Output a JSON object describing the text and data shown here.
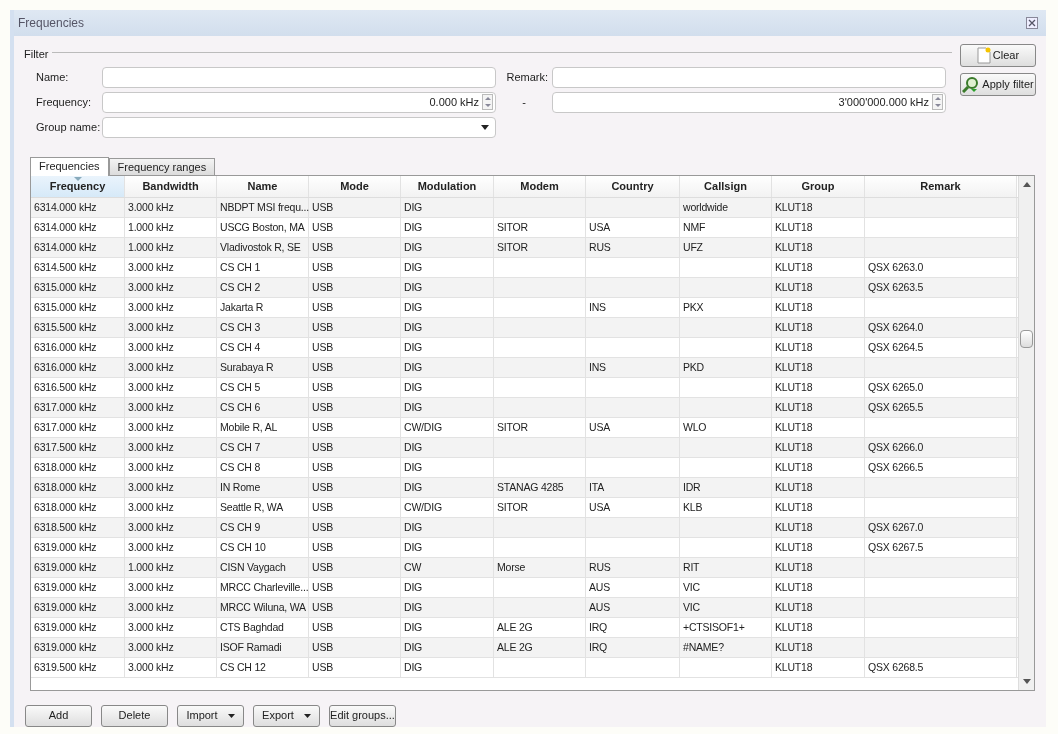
{
  "window": {
    "title": "Frequencies"
  },
  "filter": {
    "legend": "Filter",
    "name": {
      "label": "Name:"
    },
    "remark": {
      "label": "Remark:"
    },
    "frequency": {
      "label": "Frequency:",
      "from": "0.000 kHz",
      "separator": "-",
      "to": "3'000'000.000 kHz"
    },
    "group": {
      "label": "Group name:"
    },
    "buttons": [
      {
        "label": "Clear",
        "kind": "clear"
      },
      {
        "label": "Apply filter",
        "kind": "apply"
      }
    ]
  },
  "tabs": [
    {
      "label": "Frequencies",
      "selected": true
    },
    {
      "label": "Frequency ranges",
      "selected": false
    }
  ],
  "table": {
    "columns": [
      {
        "label": "Frequency",
        "sorted": true
      },
      {
        "label": "Bandwidth",
        "sorted": false
      },
      {
        "label": "Name",
        "sorted": false
      },
      {
        "label": "Mode",
        "sorted": false
      },
      {
        "label": "Modulation",
        "sorted": false
      },
      {
        "label": "Modem",
        "sorted": false
      },
      {
        "label": "Country",
        "sorted": false
      },
      {
        "label": "Callsign",
        "sorted": false
      },
      {
        "label": "Group",
        "sorted": false
      },
      {
        "label": "Remark",
        "sorted": false
      }
    ],
    "rows": [
      [
        "6314.000 kHz",
        "3.000 kHz",
        "NBDPT MSI frequ...",
        "USB",
        "DIG",
        "",
        "",
        "worldwide",
        "KLUT18",
        ""
      ],
      [
        "6314.000 kHz",
        "1.000 kHz",
        "USCG Boston, MA",
        "USB",
        "DIG",
        "SITOR",
        "USA",
        "NMF",
        "KLUT18",
        ""
      ],
      [
        "6314.000 kHz",
        "1.000 kHz",
        "Vladivostok R, SE",
        "USB",
        "DIG",
        "SITOR",
        "RUS",
        "UFZ",
        "KLUT18",
        ""
      ],
      [
        "6314.500 kHz",
        "3.000 kHz",
        "CS CH 1",
        "USB",
        "DIG",
        "",
        "",
        "",
        "KLUT18",
        "QSX 6263.0"
      ],
      [
        "6315.000 kHz",
        "3.000 kHz",
        "CS CH 2",
        "USB",
        "DIG",
        "",
        "",
        "",
        "KLUT18",
        "QSX 6263.5"
      ],
      [
        "6315.000 kHz",
        "3.000 kHz",
        "Jakarta R",
        "USB",
        "DIG",
        "",
        "INS",
        "PKX",
        "KLUT18",
        ""
      ],
      [
        "6315.500 kHz",
        "3.000 kHz",
        "CS CH 3",
        "USB",
        "DIG",
        "",
        "",
        "",
        "KLUT18",
        "QSX 6264.0"
      ],
      [
        "6316.000 kHz",
        "3.000 kHz",
        "CS CH 4",
        "USB",
        "DIG",
        "",
        "",
        "",
        "KLUT18",
        "QSX 6264.5"
      ],
      [
        "6316.000 kHz",
        "3.000 kHz",
        "Surabaya R",
        "USB",
        "DIG",
        "",
        "INS",
        "PKD",
        "KLUT18",
        ""
      ],
      [
        "6316.500 kHz",
        "3.000 kHz",
        "CS CH 5",
        "USB",
        "DIG",
        "",
        "",
        "",
        "KLUT18",
        "QSX 6265.0"
      ],
      [
        "6317.000 kHz",
        "3.000 kHz",
        "CS CH 6",
        "USB",
        "DIG",
        "",
        "",
        "",
        "KLUT18",
        "QSX 6265.5"
      ],
      [
        "6317.000 kHz",
        "3.000 kHz",
        "Mobile R, AL",
        "USB",
        "CW/DIG",
        "SITOR",
        "USA",
        "WLO",
        "KLUT18",
        ""
      ],
      [
        "6317.500 kHz",
        "3.000 kHz",
        "CS CH 7",
        "USB",
        "DIG",
        "",
        "",
        "",
        "KLUT18",
        "QSX 6266.0"
      ],
      [
        "6318.000 kHz",
        "3.000 kHz",
        "CS CH 8",
        "USB",
        "DIG",
        "",
        "",
        "",
        "KLUT18",
        "QSX 6266.5"
      ],
      [
        "6318.000 kHz",
        "3.000 kHz",
        "IN Rome",
        "USB",
        "DIG",
        "STANAG 4285",
        "ITA",
        "IDR",
        "KLUT18",
        ""
      ],
      [
        "6318.000 kHz",
        "3.000 kHz",
        "Seattle R, WA",
        "USB",
        "CW/DIG",
        "SITOR",
        "USA",
        "KLB",
        "KLUT18",
        ""
      ],
      [
        "6318.500 kHz",
        "3.000 kHz",
        "CS CH 9",
        "USB",
        "DIG",
        "",
        "",
        "",
        "KLUT18",
        "QSX 6267.0"
      ],
      [
        "6319.000 kHz",
        "3.000 kHz",
        "CS CH 10",
        "USB",
        "DIG",
        "",
        "",
        "",
        "KLUT18",
        "QSX 6267.5"
      ],
      [
        "6319.000 kHz",
        "1.000 kHz",
        "CISN Vaygach",
        "USB",
        "CW",
        "Morse",
        "RUS",
        "RIT",
        "KLUT18",
        ""
      ],
      [
        "6319.000 kHz",
        "3.000 kHz",
        "MRCC Charleville...",
        "USB",
        "DIG",
        "",
        "AUS",
        "VIC",
        "KLUT18",
        ""
      ],
      [
        "6319.000 kHz",
        "3.000 kHz",
        "MRCC Wiluna, WA",
        "USB",
        "DIG",
        "",
        "AUS",
        "VIC",
        "KLUT18",
        ""
      ],
      [
        "6319.000 kHz",
        "3.000 kHz",
        "CTS Baghdad",
        "USB",
        "DIG",
        "ALE 2G",
        "IRQ",
        "+CTSISOF1+",
        "KLUT18",
        ""
      ],
      [
        "6319.000 kHz",
        "3.000 kHz",
        "ISOF Ramadi",
        "USB",
        "DIG",
        "ALE 2G",
        "IRQ",
        "#NAME?",
        "KLUT18",
        ""
      ],
      [
        "6319.500 kHz",
        "3.000 kHz",
        "CS CH 12",
        "USB",
        "DIG",
        "",
        "",
        "",
        "KLUT18",
        "QSX 6268.5"
      ]
    ]
  },
  "buttons": [
    {
      "label": "Add",
      "kind": "plain"
    },
    {
      "label": "Delete",
      "kind": "plain"
    },
    {
      "label": "Import",
      "kind": "menu"
    },
    {
      "label": "Export",
      "kind": "menu"
    },
    {
      "label": "Edit groups...",
      "kind": "plain"
    }
  ]
}
